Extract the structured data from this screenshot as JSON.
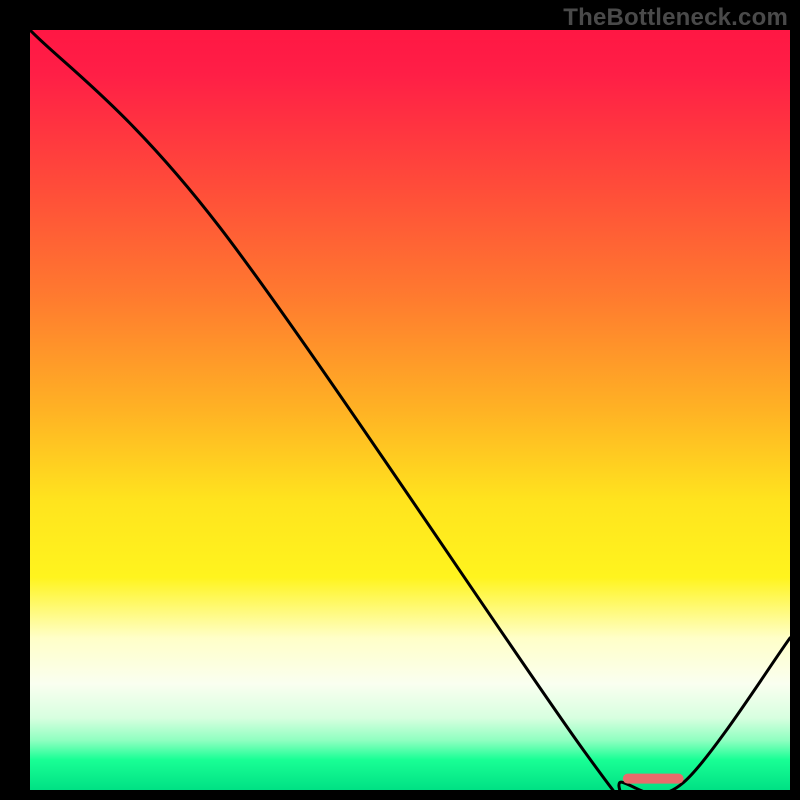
{
  "watermark": "TheBottleneck.com",
  "chart_data": {
    "type": "line",
    "title": "",
    "xlabel": "",
    "ylabel": "",
    "xlim": [
      0,
      100
    ],
    "ylim": [
      0,
      100
    ],
    "gradient_stops": [
      {
        "offset": 0.0,
        "color": "#ff1744"
      },
      {
        "offset": 0.06,
        "color": "#ff1f46"
      },
      {
        "offset": 0.2,
        "color": "#ff4a3a"
      },
      {
        "offset": 0.35,
        "color": "#ff7a2f"
      },
      {
        "offset": 0.5,
        "color": "#ffb224"
      },
      {
        "offset": 0.62,
        "color": "#ffe41e"
      },
      {
        "offset": 0.72,
        "color": "#fff41e"
      },
      {
        "offset": 0.8,
        "color": "#ffffc8"
      },
      {
        "offset": 0.86,
        "color": "#fafff0"
      },
      {
        "offset": 0.905,
        "color": "#d8ffe0"
      },
      {
        "offset": 0.935,
        "color": "#8effc0"
      },
      {
        "offset": 0.96,
        "color": "#19ff95"
      },
      {
        "offset": 1.0,
        "color": "#00e184"
      }
    ],
    "series": [
      {
        "name": "curve",
        "x": [
          0,
          25,
          73,
          78,
          86,
          100
        ],
        "values": [
          100,
          74,
          5,
          1,
          1,
          20
        ]
      }
    ],
    "marker": {
      "x_start": 78,
      "x_end": 86,
      "y": 1.5,
      "color": "#e86b6b"
    }
  }
}
